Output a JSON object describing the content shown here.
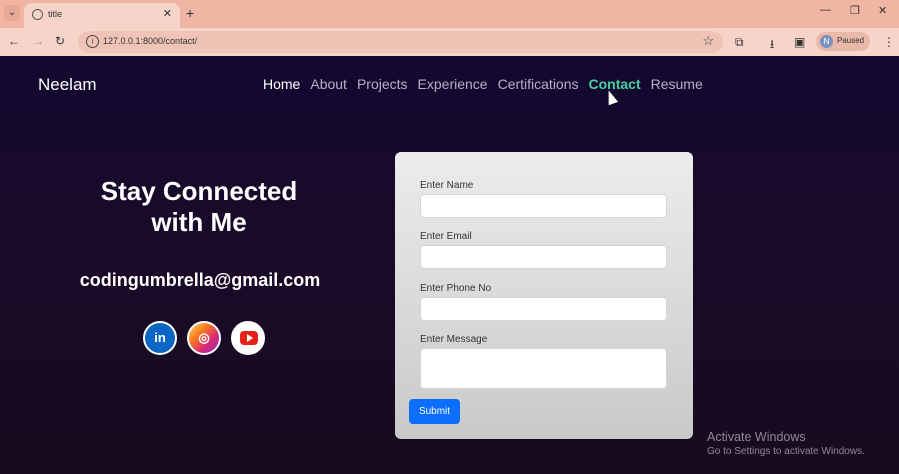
{
  "browser": {
    "tab_title": "title",
    "url": "127.0.0.1:8000/contact/",
    "profile_initial": "N",
    "profile_status": "Paused"
  },
  "site": {
    "brand": "Neelam",
    "nav": [
      "Home",
      "About",
      "Projects",
      "Experience",
      "Certifications",
      "Contact",
      "Resume"
    ],
    "active_item": "Contact"
  },
  "hero": {
    "headline_line1": "Stay Connected",
    "headline_line2": "with Me",
    "email": "codingumbrella@gmail.com",
    "socials": [
      "linkedin-icon",
      "instagram-icon",
      "youtube-icon"
    ]
  },
  "form": {
    "name_label": "Enter Name",
    "email_label": "Enter Email",
    "phone_label": "Enter Phone No",
    "message_label": "Enter Message",
    "submit_label": "Submit"
  },
  "os_overlay": {
    "activate_title": "Activate Windows",
    "activate_sub": "Go to Settings to activate Windows."
  },
  "colors": {
    "accent_active": "#47d1a0",
    "primary_button": "#0d6efd"
  }
}
